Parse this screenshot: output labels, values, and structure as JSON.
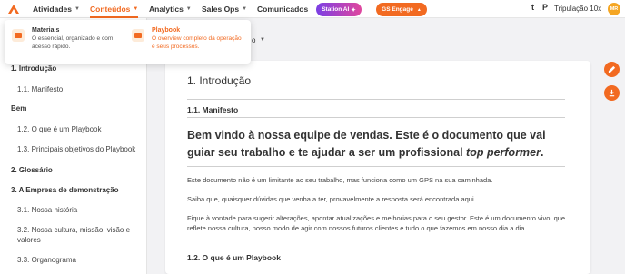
{
  "nav": {
    "items": [
      {
        "label": "Atividades"
      },
      {
        "label": "Conteúdos"
      },
      {
        "label": "Analytics"
      },
      {
        "label": "Sales Ops"
      },
      {
        "label": "Comunicados"
      }
    ],
    "station_ai": "Station AI",
    "gs_engage": "GS Engage",
    "t_icon_label": "t",
    "p_icon_label": "P",
    "team": "Tripulação 10x",
    "avatar_initials": "MR"
  },
  "dropdown": {
    "options": [
      {
        "title": "Materiais",
        "description": "O essencial, organizado e com acesso rápido."
      },
      {
        "title": "Playbook",
        "description": "O overview completo da operação e seus processos."
      }
    ]
  },
  "sidebar": {
    "items": [
      {
        "label": "1. Introdução"
      },
      {
        "label": "1.1. Manifesto"
      },
      {
        "label": "Bem"
      },
      {
        "label": "1.2. O que é um Playbook"
      },
      {
        "label": "1.3. Principais objetivos do Playbook"
      },
      {
        "label": "2. Glossário"
      },
      {
        "label": "3. A Empresa de demonstração"
      },
      {
        "label": "3.1. Nossa história"
      },
      {
        "label": "3.2. Nossa cultura, missão, visão e valores"
      },
      {
        "label": "3.3. Organograma"
      }
    ]
  },
  "content": {
    "breadcrumb_fragment": "o",
    "h1": "1. Introdução",
    "h2_manifesto": "1.1. Manifesto",
    "lead_main": "Bem vindo à nossa equipe de vendas. Este é o documento que vai guiar seu trabalho e te ajudar a ser um profissional ",
    "lead_emphasis": "top performer",
    "lead_end": ".",
    "p1": "Este documento não é um limitante ao seu trabalho, mas funciona como um GPS na sua caminhada.",
    "p2": "Saiba que, quaisquer dúvidas que venha a ter, provavelmente a resposta será encontrada aqui.",
    "p3": "Fique à vontade para sugerir alterações, apontar atualizações e melhorias para o seu gestor. Este é um documento vivo, que reflete nossa cultura, nosso modo de agir com nossos futuros clientes e tudo o que fazemos em nosso dia a dia.",
    "h2_playbook": "1.2. O que é um Playbook"
  },
  "colors": {
    "accent": "#f26a21"
  }
}
